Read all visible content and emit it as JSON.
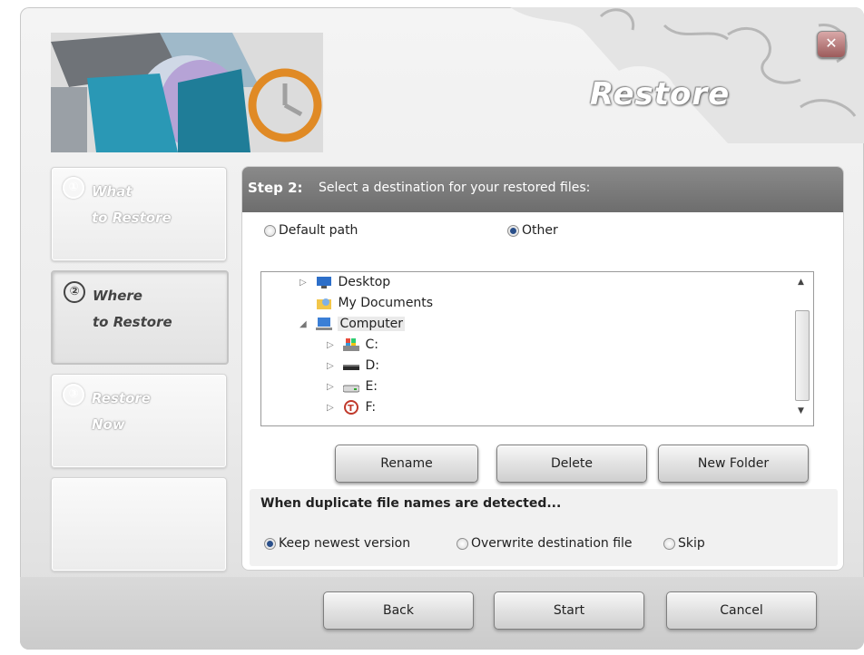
{
  "window": {
    "title": "Restore",
    "close_icon": "close-icon"
  },
  "steps": [
    {
      "number": "①",
      "label_line1": "What",
      "label_line2": "to Restore",
      "active": false
    },
    {
      "number": "②",
      "label_line1": "Where",
      "label_line2": "to Restore",
      "active": true
    },
    {
      "number": "③",
      "label_line1": "Restore",
      "label_line2": "Now",
      "active": false
    }
  ],
  "panel": {
    "step_number": "Step 2:",
    "step_text": "Select a destination for your restored files:",
    "path_options": [
      {
        "label": "Default path",
        "selected": false
      },
      {
        "label": "Other",
        "selected": true
      }
    ],
    "tree": [
      {
        "label": "Desktop",
        "icon": "desktop-icon",
        "toggle": "▷"
      },
      {
        "label": "My Documents",
        "icon": "documents-folder-icon",
        "toggle": ""
      },
      {
        "label": "Computer",
        "icon": "computer-icon",
        "toggle": "◢"
      },
      {
        "label": "C:",
        "icon": "system-drive-icon",
        "toggle": "▷"
      },
      {
        "label": "D:",
        "icon": "drive-icon",
        "toggle": "▷"
      },
      {
        "label": "E:",
        "icon": "removable-drive-icon",
        "toggle": "▷"
      },
      {
        "label": "F:",
        "icon": "drive-f-icon",
        "toggle": "▷"
      }
    ],
    "buttons": {
      "rename": "Rename",
      "delete": "Delete",
      "new_folder": "New Folder"
    },
    "duplicate_title": "When duplicate file names are detected...",
    "duplicate_options": [
      {
        "label": "Keep newest version",
        "selected": true
      },
      {
        "label": "Overwrite destination file",
        "selected": false
      },
      {
        "label": "Skip",
        "selected": false
      }
    ]
  },
  "footer": {
    "back": "Back",
    "start": "Start",
    "cancel": "Cancel"
  }
}
